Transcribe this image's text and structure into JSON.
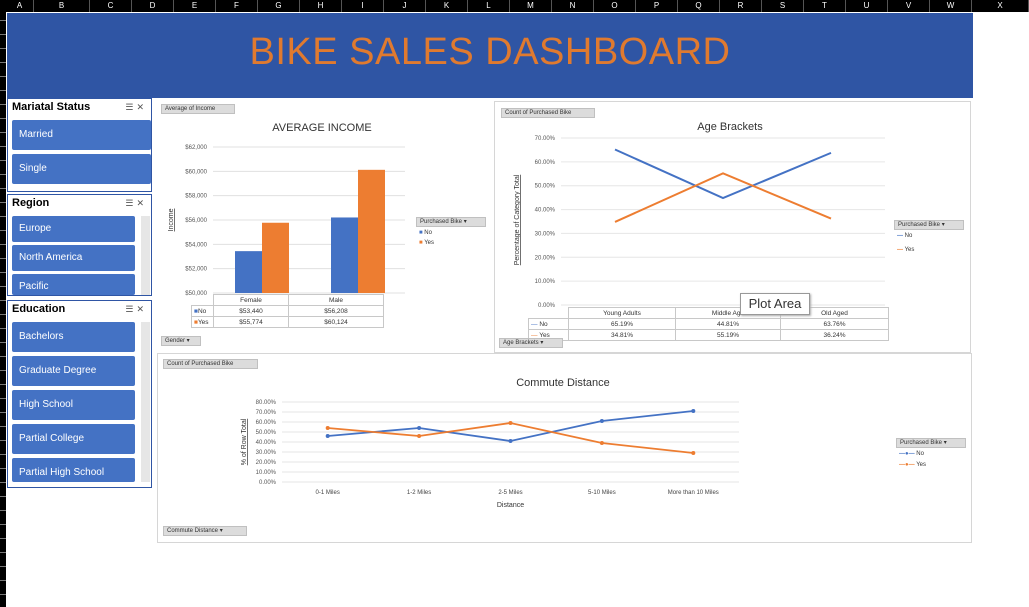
{
  "columns": [
    "A",
    "B",
    "C",
    "D",
    "E",
    "F",
    "G",
    "H",
    "I",
    "J",
    "K",
    "L",
    "M",
    "N",
    "O",
    "P",
    "Q",
    "R",
    "S",
    "T",
    "U",
    "V",
    "W",
    "X"
  ],
  "dashboard_title": "BIKE SALES DASHBOARD",
  "colors": {
    "banner": "#2f55a4",
    "title": "#e07a2f",
    "no": "#4472c4",
    "yes": "#ed7d31",
    "slicer_item": "#4472c4"
  },
  "slicers": {
    "marital": {
      "title": "Mariatal Status",
      "items": [
        "Married",
        "Single"
      ]
    },
    "region": {
      "title": "Region",
      "items": [
        "Europe",
        "North America",
        "Pacific"
      ]
    },
    "education": {
      "title": "Education",
      "items": [
        "Bachelors",
        "Graduate Degree",
        "High School",
        "Partial College",
        "Partial High School"
      ]
    }
  },
  "income_chart": {
    "field_button": "Average of Income",
    "axis_button": "Gender",
    "legend_title": "Purchased Bike",
    "chart_data": {
      "type": "bar",
      "title": "AVERAGE INCOME",
      "ylabel": "Income",
      "categories": [
        "Female",
        "Male"
      ],
      "ylim": [
        50000,
        62000
      ],
      "yticks": [
        "$50,000",
        "$52,000",
        "$54,000",
        "$56,000",
        "$58,000",
        "$60,000",
        "$62,000"
      ],
      "series": [
        {
          "name": "No",
          "values": [
            53440,
            56208
          ],
          "labels": [
            "$53,440",
            "$56,208"
          ]
        },
        {
          "name": "Yes",
          "values": [
            55774,
            60124
          ],
          "labels": [
            "$55,774",
            "$60,124"
          ]
        }
      ]
    }
  },
  "age_chart": {
    "field_button": "Count of Purchased Bike",
    "axis_button": "Age Brackets",
    "legend_title": "Purchased Bike",
    "tooltip": "Plot Area",
    "chart_data": {
      "type": "line",
      "title": "Age Brackets",
      "ylabel": "Percentage of Category Total",
      "categories": [
        "Young Adults",
        "Middle Age",
        "Old Aged"
      ],
      "ylim": [
        0,
        70
      ],
      "yticks": [
        "0.00%",
        "10.00%",
        "20.00%",
        "30.00%",
        "40.00%",
        "50.00%",
        "60.00%",
        "70.00%"
      ],
      "series": [
        {
          "name": "No",
          "values": [
            65.19,
            44.81,
            63.76
          ],
          "labels": [
            "65.19%",
            "44.81%",
            "63.76%"
          ]
        },
        {
          "name": "Yes",
          "values": [
            34.81,
            55.19,
            36.24
          ],
          "labels": [
            "34.81%",
            "55.19%",
            "36.24%"
          ]
        }
      ]
    }
  },
  "commute_chart": {
    "field_button": "Count of Purchased Bike",
    "axis_button": "Commute Distance",
    "legend_title": "Purchased Bike",
    "chart_data": {
      "type": "line",
      "title": "Commute Distance",
      "xlabel": "Distance",
      "ylabel": "% of Row Total",
      "categories": [
        "0-1 Miles",
        "1-2 Miles",
        "2-5 Miles",
        "5-10 Miles",
        "More than 10 Miles"
      ],
      "ylim": [
        0,
        80
      ],
      "yticks": [
        "0.00%",
        "10.00%",
        "20.00%",
        "30.00%",
        "40.00%",
        "50.00%",
        "60.00%",
        "70.00%",
        "80.00%"
      ],
      "series": [
        {
          "name": "No",
          "values": [
            46,
            54,
            41,
            61,
            71
          ]
        },
        {
          "name": "Yes",
          "values": [
            54,
            46,
            59,
            39,
            29
          ]
        }
      ]
    }
  }
}
